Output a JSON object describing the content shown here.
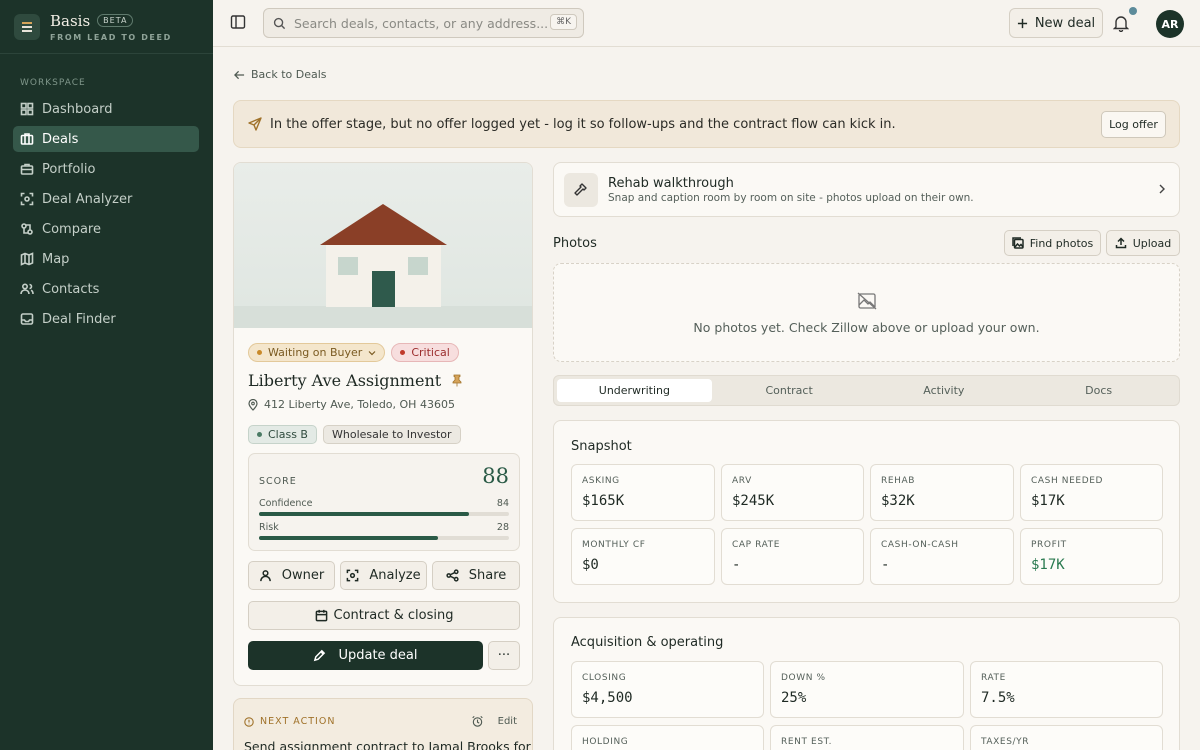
{
  "app": {
    "name": "Basis",
    "beta": "BETA",
    "tagline": "FROM LEAD TO DEED"
  },
  "sidebar": {
    "workspace_label": "WORKSPACE",
    "items": [
      {
        "label": "Dashboard",
        "icon": "grid-icon",
        "active": false
      },
      {
        "label": "Deals",
        "icon": "briefcase-icon",
        "active": true
      },
      {
        "label": "Portfolio",
        "icon": "portfolio-icon",
        "active": false
      },
      {
        "label": "Deal Analyzer",
        "icon": "scan-icon",
        "active": false
      },
      {
        "label": "Compare",
        "icon": "compare-icon",
        "active": false
      },
      {
        "label": "Map",
        "icon": "map-icon",
        "active": false
      },
      {
        "label": "Contacts",
        "icon": "users-icon",
        "active": false
      },
      {
        "label": "Deal Finder",
        "icon": "inbox-icon",
        "active": false
      }
    ]
  },
  "topbar": {
    "search_placeholder": "Search deals, contacts, or any address...",
    "search_shortcut": "⌘K",
    "new_deal_label": "New deal",
    "avatar_initials": "AR"
  },
  "back_link": "Back to Deals",
  "banner": {
    "text": "In the offer stage, but no offer logged yet - log it so follow-ups and the contract flow can kick in.",
    "action_label": "Log offer"
  },
  "deal": {
    "status_chip": "Waiting on Buyer",
    "priority_chip": "Critical",
    "title": "Liberty Ave Assignment",
    "address": "412 Liberty Ave, Toledo, OH 43605",
    "class_chip": "Class B",
    "strategy_chip": "Wholesale to Investor",
    "score_label": "SCORE",
    "score": "88",
    "confidence_label": "Confidence",
    "confidence": 84,
    "risk_label": "Risk",
    "risk": 28,
    "buttons": {
      "owner": "Owner",
      "analyze": "Analyze",
      "share": "Share",
      "contract": "Contract & closing",
      "update": "Update deal",
      "more": "···"
    }
  },
  "next_action": {
    "label": "NEXT ACTION",
    "edit": "Edit",
    "text": "Send assignment contract to Jamal Brooks for"
  },
  "rehab": {
    "title": "Rehab walkthrough",
    "subtitle": "Snap and caption room by room on site - photos upload on their own."
  },
  "photos": {
    "title": "Photos",
    "find_label": "Find photos",
    "upload_label": "Upload",
    "empty_text": "No photos yet. Check Zillow above or upload your own."
  },
  "tabs": [
    {
      "label": "Underwriting",
      "active": true
    },
    {
      "label": "Contract",
      "active": false
    },
    {
      "label": "Activity",
      "active": false
    },
    {
      "label": "Docs",
      "active": false
    }
  ],
  "snapshot": {
    "title": "Snapshot",
    "cells": [
      {
        "label": "ASKING",
        "value": "$165K"
      },
      {
        "label": "ARV",
        "value": "$245K"
      },
      {
        "label": "REHAB",
        "value": "$32K"
      },
      {
        "label": "CASH NEEDED",
        "value": "$17K"
      },
      {
        "label": "MONTHLY CF",
        "value": "$0"
      },
      {
        "label": "CAP RATE",
        "value": "-"
      },
      {
        "label": "CASH-ON-CASH",
        "value": "-"
      },
      {
        "label": "PROFIT",
        "value": "$17K"
      }
    ]
  },
  "acquisition": {
    "title": "Acquisition & operating",
    "cells": [
      {
        "label": "CLOSING",
        "value": "$4,500"
      },
      {
        "label": "DOWN %",
        "value": "25%"
      },
      {
        "label": "RATE",
        "value": "7.5%"
      },
      {
        "label": "HOLDING",
        "value": ""
      },
      {
        "label": "RENT EST.",
        "value": ""
      },
      {
        "label": "TAXES/YR",
        "value": ""
      }
    ]
  },
  "colors": {
    "sidebar_bg": "#1c3329",
    "accent": "#2a5a46",
    "warning": "#a0722a",
    "critical": "#9b2c2c"
  }
}
